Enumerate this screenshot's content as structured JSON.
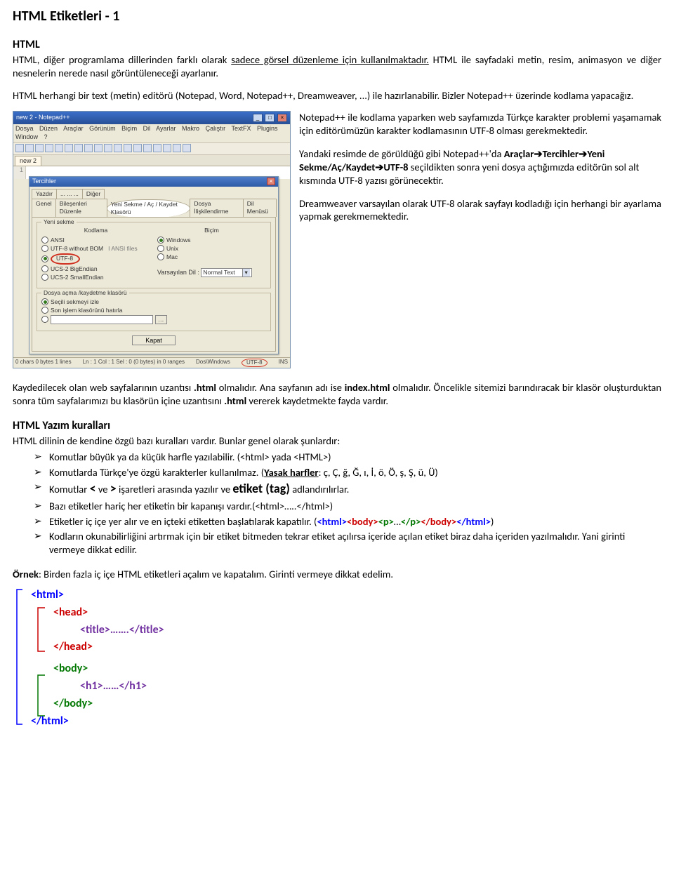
{
  "title": "HTML Etiketleri - 1",
  "s_html": {
    "heading": "HTML",
    "p1a": "HTML, diğer programlama dillerinden farklı olarak ",
    "p1u": "sadece görsel düzenleme için kullanılmaktadır.",
    "p1b": " HTML ile sayfadaki metin, resim, animasyon ve diğer nesnelerin nerede nasıl görüntüleneceği ayarlanır.",
    "p2": "HTML herhangi bir text (metin) editörü (Notepad, Word, Notepad++, Dreamweaver, ...) ile hazırlanabilir. Bizler Notepad++ üzerinde kodlama yapacağız."
  },
  "right": {
    "p1": "Notepad++ ile kodlama yaparken web sayfamızda Türkçe karakter problemi yaşamamak için editörümüzün karakter kodlamasının UTF-8 olması gerekmektedir.",
    "p2a": "Yandaki resimde de görüldüğü gibi Notepad++'da ",
    "p2b": "Araçlar➔Tercihler➔Yeni Sekme/Aç/Kaydet➔UTF-8",
    "p2c": " seçildikten sonra yeni dosya açtığımızda editörün sol alt kısmında UTF-8 yazısı görünecektir.",
    "p3": "Dreamweaver varsayılan olarak UTF-8 olarak sayfayı kodladığı için herhangi bir ayarlama yapmak gerekmemektedir."
  },
  "after_img": {
    "p1a": " Kaydedilecek olan web sayfalarının uzantısı ",
    "p1b": ".html",
    "p1c": " olmalıdır. Ana sayfanın adı ise ",
    "p1d": "index.html",
    "p1e": " olmalıdır. Öncelikle sitemizi barındıracak bir klasör oluşturduktan sonra tüm sayfalarımızı bu klasörün içine uzantısını ",
    "p1f": ".html",
    "p1g": " vererek kaydetmekte fayda vardır."
  },
  "rules": {
    "heading": "HTML Yazım kuralları",
    "intro": "HTML dilinin de kendine özgü bazı kuralları vardır. Bunlar genel olarak şunlardır:",
    "r1": "Komutlar büyük ya da küçük harfle yazılabilir.  (<html> yada <HTML>)",
    "r2a": "Komutlarda Türkçe'ye özgü karakterler kullanılmaz. (",
    "r2b": "Yasak harfler",
    "r2c": ": ç, Ç, ğ, Ğ, ı, İ, ö, Ö, ş, Ş, ü, Ü)",
    "r3a": "Komutlar ",
    "r3b": "<",
    "r3c": " ve ",
    "r3d": ">",
    "r3e": " işaretleri arasında yazılır ve ",
    "r3f": "etiket (tag)",
    "r3g": " adlandırılırlar.",
    "r4": "Bazı etiketler hariç her etiketin bir kapanışı vardır.(<html>…..</html>)",
    "r5a": "Etiketler iç içe yer alır ve en içteki etiketten başlatılarak kapatılır. (",
    "r5_html_o": "<html>",
    "r5_body_o": "<body>",
    "r5_p_o": "<p>",
    "r5_dots": "…",
    "r5_p_c": "</p>",
    "r5_body_c": "</body>",
    "r5_html_c": "</html>",
    "r5b": ")",
    "r6": "Kodların okunabilirliğini artırmak için bir etiket bitmeden tekrar etiket açılırsa içeride açılan etiket biraz daha içeriden yazılmalıdır.  Yani girinti vermeye dikkat edilir."
  },
  "example": {
    "lead_b": "Örnek",
    "lead": ": Birden fazla iç içe HTML etiketleri açalım ve kapatalım. Girinti vermeye dikkat edelim.",
    "l1": "<html>",
    "l2": "<head>",
    "l3": "<title>…….</title>",
    "l4": "</head>",
    "l5": "<body>",
    "l6": "<h1>……</h1>",
    "l7": "</body>",
    "l8": "</html>"
  },
  "npp": {
    "window_title": "new 2 - Notepad++",
    "menus": [
      "Dosya",
      "Düzen",
      "Araçlar",
      "Görünüm",
      "Biçim",
      "Dil",
      "Ayarlar",
      "Makro",
      "Çalıştır",
      "TextFX",
      "Plugins",
      "Window",
      "?"
    ],
    "tab": "new 2",
    "line_no": "1",
    "dialog_title": "Tercihler",
    "tabs_row1": [
      "Yazdır",
      "... ... ...",
      "Diğer"
    ],
    "tabs_row2": [
      "Genel",
      "Bileşenleri Düzenle",
      "Yeni Sekme / Aç / Kaydet Klasörü",
      "Dosya İlişkilendirme",
      "Dil Menüsü"
    ],
    "fs1_legend": "Yeni sekme",
    "col_left_title": "Kodlama",
    "col_right_title": "Biçim",
    "enc_opts": [
      "ANSI",
      "UTF-8 without BOM",
      "UTF-8",
      "UCS-2 BigEndian",
      "UCS-2 SmallEndian"
    ],
    "enc_note": "I ANSI files",
    "fmt_opts": [
      "Windows",
      "Unix",
      "Mac"
    ],
    "default_lang_label": "Varsayılan Dil :",
    "default_lang_value": "Normal Text",
    "fs2_legend": "Dosya açma /kaydetme klasörü",
    "save_opts": [
      "Seçili sekmeyi izle",
      "Son işlem klasörünü hatırla",
      ""
    ],
    "close_btn": "Kapat",
    "status": {
      "left": "0 chars   0 bytes   1 lines",
      "mid": "Ln : 1    Col : 1    Sel : 0 (0 bytes) in 0 ranges",
      "enc1": "Dos\\Windows",
      "enc2": "UTF-8",
      "ins": "INS"
    }
  }
}
